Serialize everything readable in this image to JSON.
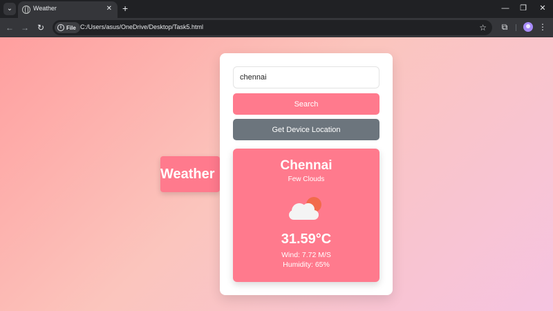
{
  "browser": {
    "tab": {
      "title": "Weather",
      "close": "✕"
    },
    "new_tab": "+",
    "window_controls": {
      "minimize": "—",
      "restore": "❐",
      "close": "✕"
    },
    "nav": {
      "back": "←",
      "forward": "→",
      "reload": "↻"
    },
    "site_info_label": "File",
    "url": "C:/Users/asus/OneDrive/Desktop/Task5.html",
    "icons": [
      "tab-menu-icon",
      "globe-icon",
      "info-icon",
      "star-icon",
      "extensions-icon",
      "more-icon"
    ]
  },
  "app": {
    "side_title": "Weather",
    "search": {
      "value": "chennai",
      "button_label": "Search"
    },
    "location_button_label": "Get Device Location",
    "weather": {
      "city": "Chennai",
      "condition": "Few Clouds",
      "icon": "cloud-sun-icon",
      "temperature": "31.59°C",
      "wind": "Wind: 7.72 M/S",
      "humidity": "Humidity: 65%"
    }
  },
  "colors": {
    "accent": "#ff7a8d",
    "secondary_button": "#6c757d",
    "card_bg": "#ffffff",
    "chrome_dark": "#202124"
  }
}
